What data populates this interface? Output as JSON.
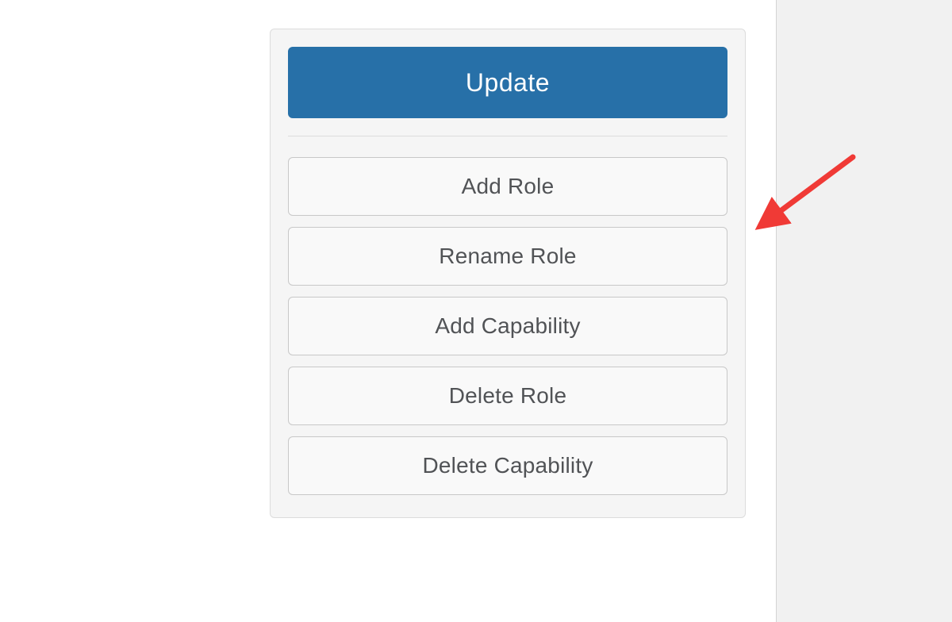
{
  "panel": {
    "primary_label": "Update",
    "actions": [
      "Add Role",
      "Rename Role",
      "Add Capability",
      "Delete Role",
      "Delete Capability"
    ]
  },
  "colors": {
    "primary": "#2770a8",
    "arrow": "#f03a36"
  }
}
